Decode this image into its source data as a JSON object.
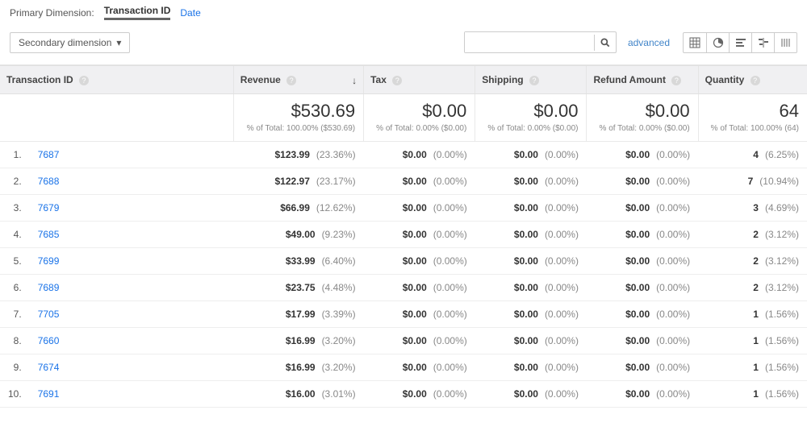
{
  "primaryDimension": {
    "label": "Primary Dimension:",
    "active": "Transaction ID",
    "alt": "Date"
  },
  "secondaryDimension": {
    "label": "Secondary dimension"
  },
  "advancedLabel": "advanced",
  "columns": {
    "transactionId": "Transaction ID",
    "revenue": "Revenue",
    "tax": "Tax",
    "shipping": "Shipping",
    "refund": "Refund Amount",
    "quantity": "Quantity"
  },
  "totals": {
    "revenue": {
      "value": "$530.69",
      "sub": "% of Total: 100.00% ($530.69)"
    },
    "tax": {
      "value": "$0.00",
      "sub": "% of Total: 0.00% ($0.00)"
    },
    "shipping": {
      "value": "$0.00",
      "sub": "% of Total: 0.00% ($0.00)"
    },
    "refund": {
      "value": "$0.00",
      "sub": "% of Total: 0.00% ($0.00)"
    },
    "quantity": {
      "value": "64",
      "sub": "% of Total: 100.00% (64)"
    }
  },
  "rows": [
    {
      "n": "1.",
      "id": "7687",
      "revenue": "$123.99",
      "revenuePct": "(23.36%)",
      "tax": "$0.00",
      "taxPct": "(0.00%)",
      "shipping": "$0.00",
      "shippingPct": "(0.00%)",
      "refund": "$0.00",
      "refundPct": "(0.00%)",
      "qty": "4",
      "qtyPct": "(6.25%)"
    },
    {
      "n": "2.",
      "id": "7688",
      "revenue": "$122.97",
      "revenuePct": "(23.17%)",
      "tax": "$0.00",
      "taxPct": "(0.00%)",
      "shipping": "$0.00",
      "shippingPct": "(0.00%)",
      "refund": "$0.00",
      "refundPct": "(0.00%)",
      "qty": "7",
      "qtyPct": "(10.94%)"
    },
    {
      "n": "3.",
      "id": "7679",
      "revenue": "$66.99",
      "revenuePct": "(12.62%)",
      "tax": "$0.00",
      "taxPct": "(0.00%)",
      "shipping": "$0.00",
      "shippingPct": "(0.00%)",
      "refund": "$0.00",
      "refundPct": "(0.00%)",
      "qty": "3",
      "qtyPct": "(4.69%)"
    },
    {
      "n": "4.",
      "id": "7685",
      "revenue": "$49.00",
      "revenuePct": "(9.23%)",
      "tax": "$0.00",
      "taxPct": "(0.00%)",
      "shipping": "$0.00",
      "shippingPct": "(0.00%)",
      "refund": "$0.00",
      "refundPct": "(0.00%)",
      "qty": "2",
      "qtyPct": "(3.12%)"
    },
    {
      "n": "5.",
      "id": "7699",
      "revenue": "$33.99",
      "revenuePct": "(6.40%)",
      "tax": "$0.00",
      "taxPct": "(0.00%)",
      "shipping": "$0.00",
      "shippingPct": "(0.00%)",
      "refund": "$0.00",
      "refundPct": "(0.00%)",
      "qty": "2",
      "qtyPct": "(3.12%)"
    },
    {
      "n": "6.",
      "id": "7689",
      "revenue": "$23.75",
      "revenuePct": "(4.48%)",
      "tax": "$0.00",
      "taxPct": "(0.00%)",
      "shipping": "$0.00",
      "shippingPct": "(0.00%)",
      "refund": "$0.00",
      "refundPct": "(0.00%)",
      "qty": "2",
      "qtyPct": "(3.12%)"
    },
    {
      "n": "7.",
      "id": "7705",
      "revenue": "$17.99",
      "revenuePct": "(3.39%)",
      "tax": "$0.00",
      "taxPct": "(0.00%)",
      "shipping": "$0.00",
      "shippingPct": "(0.00%)",
      "refund": "$0.00",
      "refundPct": "(0.00%)",
      "qty": "1",
      "qtyPct": "(1.56%)"
    },
    {
      "n": "8.",
      "id": "7660",
      "revenue": "$16.99",
      "revenuePct": "(3.20%)",
      "tax": "$0.00",
      "taxPct": "(0.00%)",
      "shipping": "$0.00",
      "shippingPct": "(0.00%)",
      "refund": "$0.00",
      "refundPct": "(0.00%)",
      "qty": "1",
      "qtyPct": "(1.56%)"
    },
    {
      "n": "9.",
      "id": "7674",
      "revenue": "$16.99",
      "revenuePct": "(3.20%)",
      "tax": "$0.00",
      "taxPct": "(0.00%)",
      "shipping": "$0.00",
      "shippingPct": "(0.00%)",
      "refund": "$0.00",
      "refundPct": "(0.00%)",
      "qty": "1",
      "qtyPct": "(1.56%)"
    },
    {
      "n": "10.",
      "id": "7691",
      "revenue": "$16.00",
      "revenuePct": "(3.01%)",
      "tax": "$0.00",
      "taxPct": "(0.00%)",
      "shipping": "$0.00",
      "shippingPct": "(0.00%)",
      "refund": "$0.00",
      "refundPct": "(0.00%)",
      "qty": "1",
      "qtyPct": "(1.56%)"
    }
  ]
}
